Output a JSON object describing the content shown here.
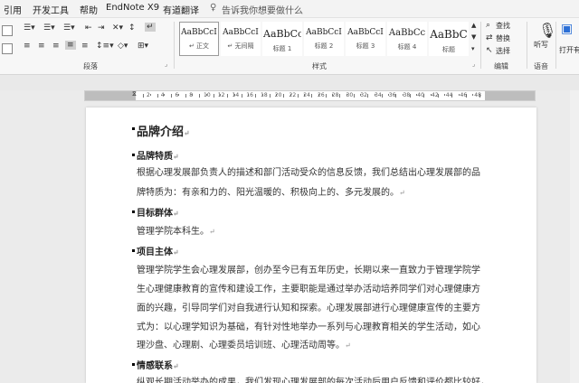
{
  "menu": {
    "tabs": [
      "引用",
      "开发工具",
      "帮助",
      "EndNote X9",
      "有道翻译"
    ],
    "tell_me": "告诉我你想要做什么"
  },
  "ribbon": {
    "groups": {
      "paragraph": "段落",
      "styles": "样式",
      "editing": "编辑",
      "voice": "语音"
    },
    "styles": [
      {
        "preview": "AaBbCcI",
        "name": "↵ 正文"
      },
      {
        "preview": "AaBbCcI",
        "name": "↵ 无间隔"
      },
      {
        "preview": "AaBbCc",
        "name": "标题 1"
      },
      {
        "preview": "AaBbCcI",
        "name": "标题 2"
      },
      {
        "preview": "AaBbCcI",
        "name": "标题 3"
      },
      {
        "preview": "AaBbCc",
        "name": "标题 4"
      },
      {
        "preview": "AaBbC",
        "name": "标题"
      }
    ],
    "editing": {
      "find": "查找",
      "replace": "替换",
      "select": "选择"
    },
    "dictate": "听写",
    "youdao": "打开有道"
  },
  "ruler": {
    "numbers": [
      "2",
      "4",
      "6",
      "8",
      "10",
      "12",
      "14",
      "16",
      "18",
      "20",
      "22",
      "24",
      "26",
      "28",
      "30",
      "32",
      "34",
      "36",
      "38",
      "40",
      "42",
      "44",
      "46",
      "48"
    ]
  },
  "document": {
    "title": "品牌介绍",
    "sections": [
      {
        "heading": "品牌特质",
        "lines": [
          "根据心理发展部负责人的描述和部门活动受众的信息反馈，我们总结出心理发展部的品",
          "牌特质为：有亲和力的、阳光温暖的、积极向上的、多元发展的。"
        ]
      },
      {
        "heading": "目标群体",
        "lines": [
          "管理学院本科生。"
        ]
      },
      {
        "heading": "项目主体",
        "lines": [
          "管理学院学生会心理发展部，创办至今已有五年历史，长期以来一直致力于管理学院学",
          "生心理健康教育的宣传和建设工作，主要职能是通过举办活动培养同学们对心理健康方",
          "面的兴趣，引导同学们对自我进行认知和探索。心理发展部进行心理健康宣传的主要方",
          "式为：以心理学知识为基础，有针对性地举办一系列与心理教育相关的学生活动，如心",
          "理沙盘、心理剧、心理委员培训班、心理活动周等。"
        ]
      },
      {
        "heading": "情感联系",
        "lines": [
          "纵观长期活动举办的成果，我们发现心理发展部的每次活动后用户反馈和评价都比较好，"
        ]
      }
    ]
  }
}
